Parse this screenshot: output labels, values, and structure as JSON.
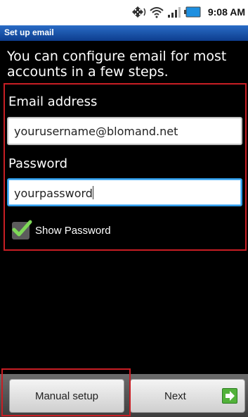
{
  "status_bar": {
    "time": "9:08 AM",
    "icons": [
      "sync-icon",
      "wifi-icon",
      "signal-icon",
      "battery-icon"
    ]
  },
  "title_bar": {
    "title": "Set up email"
  },
  "intro_text": "You can configure email for most accounts in a few steps.",
  "email": {
    "label": "Email address",
    "value": "yourusername@blomand.net"
  },
  "password": {
    "label": "Password",
    "value": "yourpassword"
  },
  "show_password": {
    "label": "Show Password",
    "checked": true
  },
  "buttons": {
    "manual_setup": "Manual setup",
    "next": "Next"
  },
  "colors": {
    "title_bar": "#1a52a8",
    "highlight": "#c81e24",
    "focus": "#2f9be8",
    "check": "#7ed957",
    "next_arrow": "#52b23a"
  }
}
